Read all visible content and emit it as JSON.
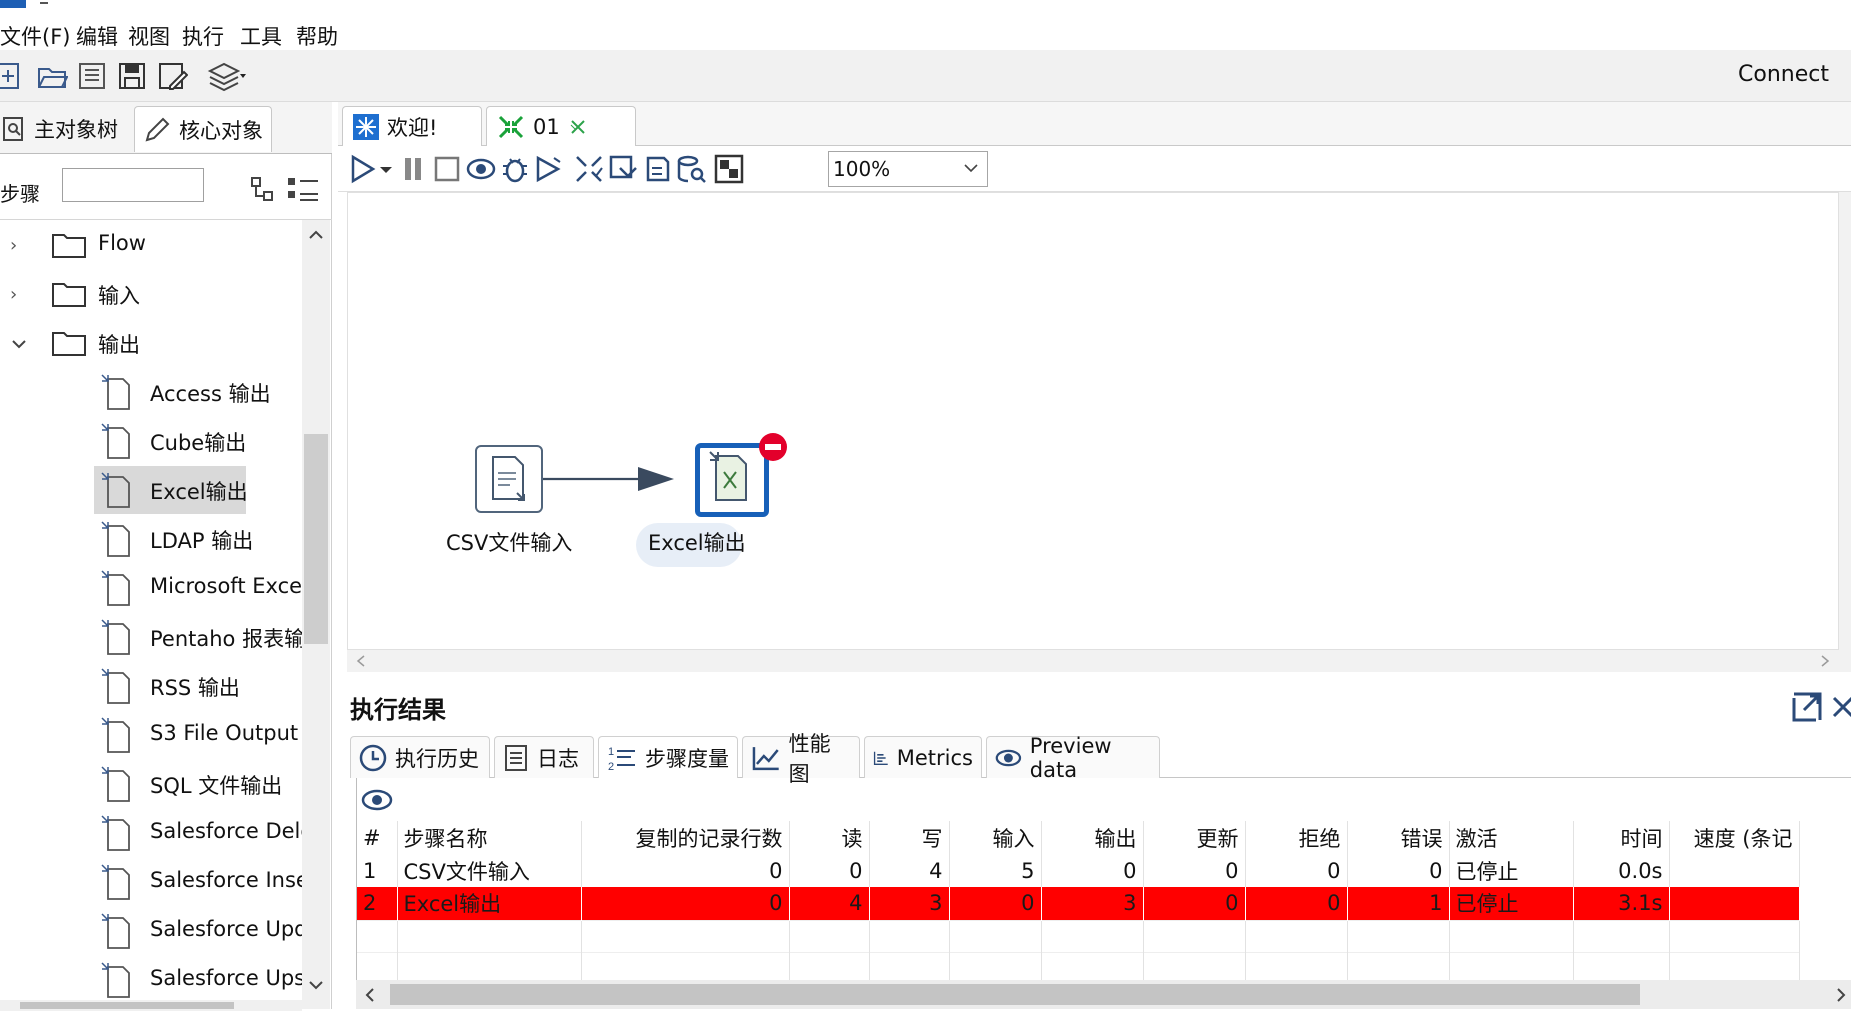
{
  "menubar": {
    "items": [
      "文件(F)",
      "编辑",
      "视图",
      "执行",
      "工具",
      "帮助"
    ]
  },
  "toolbar": {
    "connect_label": "Connect"
  },
  "left_panel": {
    "tabs": [
      "主对象树",
      "核心对象"
    ],
    "search_label": "步骤",
    "search_value": "",
    "folders": [
      {
        "label": "Flow",
        "expanded": false
      },
      {
        "label": "输入",
        "expanded": false
      },
      {
        "label": "输出",
        "expanded": true
      }
    ],
    "steps": [
      {
        "label": "Access 输出",
        "icon": "access-output-icon"
      },
      {
        "label": "Cube输出",
        "icon": "cube-output-icon"
      },
      {
        "label": "Excel输出",
        "icon": "excel-output-icon",
        "selected": true
      },
      {
        "label": "LDAP 输出",
        "icon": "ldap-output-icon"
      },
      {
        "label": "Microsoft Excel",
        "icon": "microsoft-excel-output-icon"
      },
      {
        "label": "Pentaho 报表输",
        "icon": "pentaho-report-output-icon"
      },
      {
        "label": "RSS 输出",
        "icon": "rss-output-icon"
      },
      {
        "label": "S3 File Output",
        "icon": "s3-file-output-icon"
      },
      {
        "label": "SQL 文件输出",
        "icon": "sql-file-output-icon"
      },
      {
        "label": "Salesforce Dele",
        "icon": "salesforce-delete-icon"
      },
      {
        "label": "Salesforce Inse",
        "icon": "salesforce-insert-icon"
      },
      {
        "label": "Salesforce Upd",
        "icon": "salesforce-update-icon"
      },
      {
        "label": "Salesforce Ups",
        "icon": "salesforce-upsert-icon"
      }
    ]
  },
  "editor": {
    "tabs": [
      {
        "label": "欢迎!",
        "icon": "welcome-icon"
      },
      {
        "label": "01",
        "icon": "transformation-icon",
        "closable": true,
        "active": true
      }
    ],
    "zoom": "100%"
  },
  "canvas": {
    "nodes": [
      {
        "label": "CSV文件输入",
        "icon": "csv-input-icon"
      },
      {
        "label": "Excel输出",
        "icon": "excel-output-icon",
        "error": true
      }
    ]
  },
  "results": {
    "title": "执行结果",
    "tabs": [
      {
        "label": "执行历史",
        "icon": "history-icon"
      },
      {
        "label": "日志",
        "icon": "log-icon"
      },
      {
        "label": "步骤度量",
        "icon": "step-metrics-icon",
        "active": true
      },
      {
        "label": "性能图",
        "icon": "performance-icon"
      },
      {
        "label": "Metrics",
        "icon": "metrics-icon"
      },
      {
        "label": "Preview data",
        "icon": "preview-icon"
      }
    ],
    "columns": [
      "#",
      "步骤名称",
      "复制的记录行数",
      "读",
      "写",
      "输入",
      "输出",
      "更新",
      "拒绝",
      "错误",
      "激活",
      "时间",
      "速度 (条记"
    ],
    "rows": [
      [
        "1",
        "CSV文件输入",
        "0",
        "0",
        "4",
        "5",
        "0",
        "0",
        "0",
        "0",
        "已停止",
        "0.0s",
        ""
      ],
      [
        "2",
        "Excel输出",
        "0",
        "4",
        "3",
        "0",
        "3",
        "0",
        "0",
        "1",
        "已停止",
        "3.1s",
        ""
      ]
    ],
    "error_color": "#ff0000"
  }
}
